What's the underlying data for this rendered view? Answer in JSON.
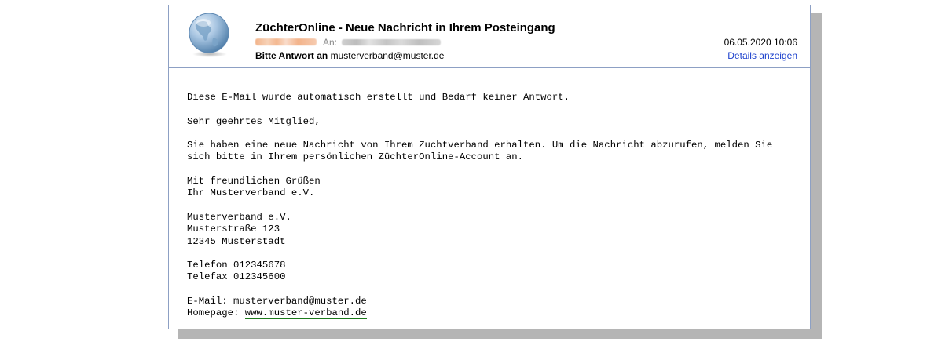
{
  "header": {
    "subject": "ZüchterOnline - Neue Nachricht in Ihrem Posteingang",
    "to_label": "An:",
    "reply_to_label": "Bitte Antwort an",
    "reply_to_address": "musterverband@muster.de",
    "date": "06.05.2020 10:06",
    "details_link": "Details anzeigen",
    "avatar_icon": "globe-icon"
  },
  "body": {
    "auto_notice": "Diese E-Mail wurde automatisch erstellt und Bedarf keiner Antwort.",
    "greeting": "Sehr geehrtes Mitglied,",
    "message": "Sie haben eine neue Nachricht von Ihrem Zuchtverband erhalten. Um die Nachricht abzurufen, melden Sie sich bitte in Ihrem persönlichen ZüchterOnline-Account an.",
    "closing_1": "Mit freundlichen Grüßen",
    "closing_2": "Ihr Musterverband e.V.",
    "org_name": "Musterverband e.V.",
    "street": "Musterstraße 123",
    "city": "12345 Musterstadt",
    "phone": "Telefon 012345678",
    "fax": "Telefax 012345600",
    "email_line": "E-Mail: musterverband@muster.de",
    "homepage_label": "Homepage: ",
    "homepage_url": "www.muster-verband.de"
  },
  "colors": {
    "border": "#8da0c4",
    "link": "#1a3fcc",
    "homepage_underline": "#1c7a1c",
    "shadow": "#b5b5b5"
  }
}
